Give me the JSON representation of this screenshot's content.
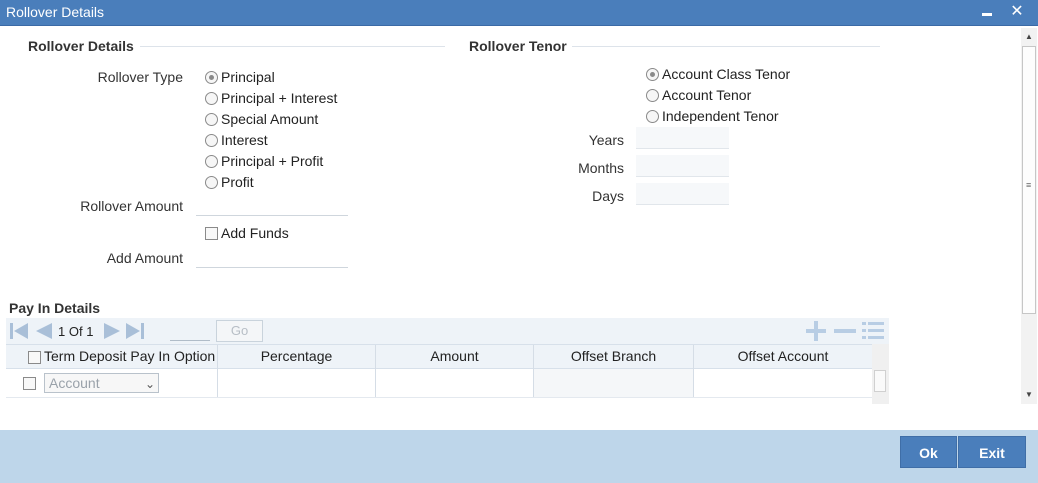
{
  "window": {
    "title": "Rollover Details",
    "minimize_icon": "minimize-icon",
    "close_icon": "close-icon",
    "close_glyph": "✕"
  },
  "rollover_details": {
    "section_title": "Rollover Details",
    "rollover_type_label": "Rollover Type",
    "rollover_type_options": [
      {
        "label": "Principal",
        "selected": true
      },
      {
        "label": "Principal + Interest",
        "selected": false
      },
      {
        "label": "Special Amount",
        "selected": false
      },
      {
        "label": "Interest",
        "selected": false
      },
      {
        "label": "Principal + Profit",
        "selected": false
      },
      {
        "label": "Profit",
        "selected": false
      }
    ],
    "rollover_amount_label": "Rollover Amount",
    "rollover_amount_value": "",
    "add_funds_label": "Add Funds",
    "add_funds_checked": false,
    "add_amount_label": "Add Amount",
    "add_amount_value": ""
  },
  "rollover_tenor": {
    "section_title": "Rollover Tenor",
    "options": [
      {
        "label": "Account Class Tenor",
        "selected": true
      },
      {
        "label": "Account Tenor",
        "selected": false
      },
      {
        "label": "Independent Tenor",
        "selected": false
      }
    ],
    "years_label": "Years",
    "years_value": "",
    "months_label": "Months",
    "months_value": "",
    "days_label": "Days",
    "days_value": ""
  },
  "pay_in": {
    "section_title": "Pay In Details",
    "pager": {
      "current": "1",
      "of_label": "Of",
      "total": "1",
      "page_input": "",
      "go_label": "Go"
    },
    "columns": [
      "Term Deposit Pay In Option",
      "Percentage",
      "Amount",
      "Offset Branch",
      "Offset Account"
    ],
    "rows": [
      {
        "option": "Account",
        "percentage": "",
        "amount": "",
        "offset_branch": "",
        "offset_account": ""
      }
    ]
  },
  "footer": {
    "ok_label": "Ok",
    "exit_label": "Exit"
  },
  "colors": {
    "title_bar": "#4a7ebb",
    "footer": "#bed6ea",
    "button": "#4a7ebb"
  }
}
